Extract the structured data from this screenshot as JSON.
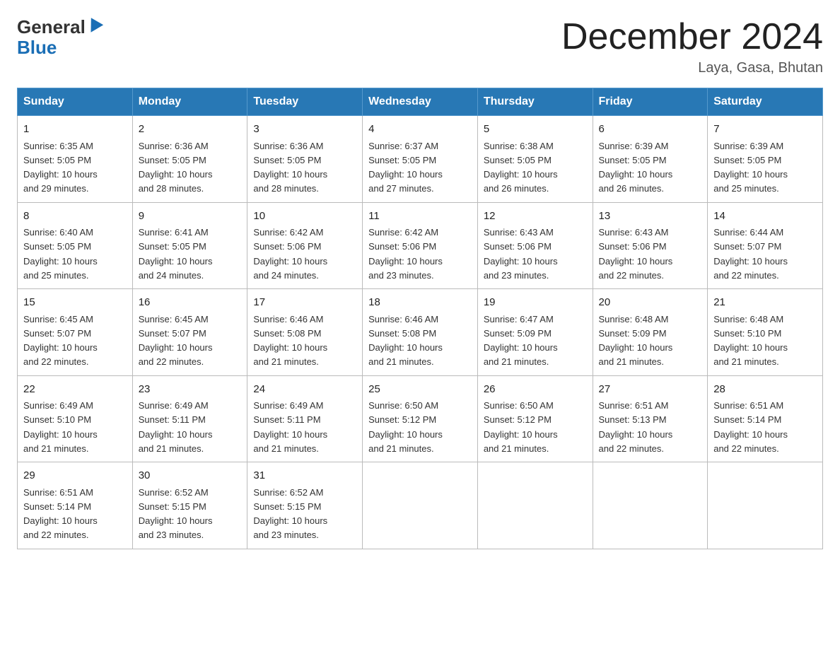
{
  "header": {
    "logo_general": "General",
    "logo_blue": "Blue",
    "month_title": "December 2024",
    "subtitle": "Laya, Gasa, Bhutan"
  },
  "days_of_week": [
    "Sunday",
    "Monday",
    "Tuesday",
    "Wednesday",
    "Thursday",
    "Friday",
    "Saturday"
  ],
  "weeks": [
    [
      {
        "day": "1",
        "sunrise": "6:35 AM",
        "sunset": "5:05 PM",
        "daylight": "10 hours and 29 minutes."
      },
      {
        "day": "2",
        "sunrise": "6:36 AM",
        "sunset": "5:05 PM",
        "daylight": "10 hours and 28 minutes."
      },
      {
        "day": "3",
        "sunrise": "6:36 AM",
        "sunset": "5:05 PM",
        "daylight": "10 hours and 28 minutes."
      },
      {
        "day": "4",
        "sunrise": "6:37 AM",
        "sunset": "5:05 PM",
        "daylight": "10 hours and 27 minutes."
      },
      {
        "day": "5",
        "sunrise": "6:38 AM",
        "sunset": "5:05 PM",
        "daylight": "10 hours and 26 minutes."
      },
      {
        "day": "6",
        "sunrise": "6:39 AM",
        "sunset": "5:05 PM",
        "daylight": "10 hours and 26 minutes."
      },
      {
        "day": "7",
        "sunrise": "6:39 AM",
        "sunset": "5:05 PM",
        "daylight": "10 hours and 25 minutes."
      }
    ],
    [
      {
        "day": "8",
        "sunrise": "6:40 AM",
        "sunset": "5:05 PM",
        "daylight": "10 hours and 25 minutes."
      },
      {
        "day": "9",
        "sunrise": "6:41 AM",
        "sunset": "5:05 PM",
        "daylight": "10 hours and 24 minutes."
      },
      {
        "day": "10",
        "sunrise": "6:42 AM",
        "sunset": "5:06 PM",
        "daylight": "10 hours and 24 minutes."
      },
      {
        "day": "11",
        "sunrise": "6:42 AM",
        "sunset": "5:06 PM",
        "daylight": "10 hours and 23 minutes."
      },
      {
        "day": "12",
        "sunrise": "6:43 AM",
        "sunset": "5:06 PM",
        "daylight": "10 hours and 23 minutes."
      },
      {
        "day": "13",
        "sunrise": "6:43 AM",
        "sunset": "5:06 PM",
        "daylight": "10 hours and 22 minutes."
      },
      {
        "day": "14",
        "sunrise": "6:44 AM",
        "sunset": "5:07 PM",
        "daylight": "10 hours and 22 minutes."
      }
    ],
    [
      {
        "day": "15",
        "sunrise": "6:45 AM",
        "sunset": "5:07 PM",
        "daylight": "10 hours and 22 minutes."
      },
      {
        "day": "16",
        "sunrise": "6:45 AM",
        "sunset": "5:07 PM",
        "daylight": "10 hours and 22 minutes."
      },
      {
        "day": "17",
        "sunrise": "6:46 AM",
        "sunset": "5:08 PM",
        "daylight": "10 hours and 21 minutes."
      },
      {
        "day": "18",
        "sunrise": "6:46 AM",
        "sunset": "5:08 PM",
        "daylight": "10 hours and 21 minutes."
      },
      {
        "day": "19",
        "sunrise": "6:47 AM",
        "sunset": "5:09 PM",
        "daylight": "10 hours and 21 minutes."
      },
      {
        "day": "20",
        "sunrise": "6:48 AM",
        "sunset": "5:09 PM",
        "daylight": "10 hours and 21 minutes."
      },
      {
        "day": "21",
        "sunrise": "6:48 AM",
        "sunset": "5:10 PM",
        "daylight": "10 hours and 21 minutes."
      }
    ],
    [
      {
        "day": "22",
        "sunrise": "6:49 AM",
        "sunset": "5:10 PM",
        "daylight": "10 hours and 21 minutes."
      },
      {
        "day": "23",
        "sunrise": "6:49 AM",
        "sunset": "5:11 PM",
        "daylight": "10 hours and 21 minutes."
      },
      {
        "day": "24",
        "sunrise": "6:49 AM",
        "sunset": "5:11 PM",
        "daylight": "10 hours and 21 minutes."
      },
      {
        "day": "25",
        "sunrise": "6:50 AM",
        "sunset": "5:12 PM",
        "daylight": "10 hours and 21 minutes."
      },
      {
        "day": "26",
        "sunrise": "6:50 AM",
        "sunset": "5:12 PM",
        "daylight": "10 hours and 21 minutes."
      },
      {
        "day": "27",
        "sunrise": "6:51 AM",
        "sunset": "5:13 PM",
        "daylight": "10 hours and 22 minutes."
      },
      {
        "day": "28",
        "sunrise": "6:51 AM",
        "sunset": "5:14 PM",
        "daylight": "10 hours and 22 minutes."
      }
    ],
    [
      {
        "day": "29",
        "sunrise": "6:51 AM",
        "sunset": "5:14 PM",
        "daylight": "10 hours and 22 minutes."
      },
      {
        "day": "30",
        "sunrise": "6:52 AM",
        "sunset": "5:15 PM",
        "daylight": "10 hours and 23 minutes."
      },
      {
        "day": "31",
        "sunrise": "6:52 AM",
        "sunset": "5:15 PM",
        "daylight": "10 hours and 23 minutes."
      },
      null,
      null,
      null,
      null
    ]
  ],
  "labels": {
    "sunrise": "Sunrise:",
    "sunset": "Sunset:",
    "daylight": "Daylight:"
  }
}
